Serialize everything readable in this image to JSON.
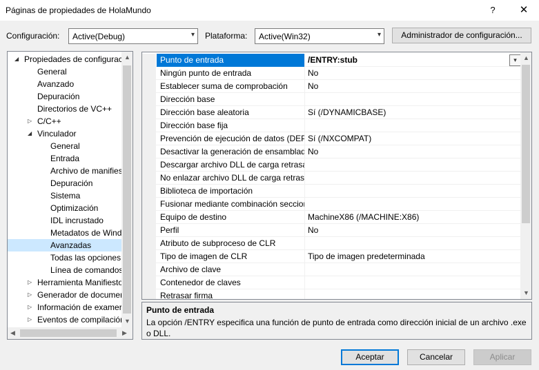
{
  "window": {
    "title": "Páginas de propiedades de HolaMundo",
    "help": "?",
    "close": "✕"
  },
  "config": {
    "label": "Configuración:",
    "value": "Active(Debug)",
    "platform_label": "Plataforma:",
    "platform_value": "Active(Win32)",
    "manager_button": "Administrador de configuración..."
  },
  "tree": {
    "items": [
      {
        "label": "Propiedades de configurac",
        "level": 0,
        "caret": "expanded"
      },
      {
        "label": "General",
        "level": 1
      },
      {
        "label": "Avanzado",
        "level": 1
      },
      {
        "label": "Depuración",
        "level": 1
      },
      {
        "label": "Directorios de VC++",
        "level": 1
      },
      {
        "label": "C/C++",
        "level": 1,
        "caret": "collapsed"
      },
      {
        "label": "Vinculador",
        "level": 1,
        "caret": "expanded"
      },
      {
        "label": "General",
        "level": 2
      },
      {
        "label": "Entrada",
        "level": 2
      },
      {
        "label": "Archivo de manifies",
        "level": 2
      },
      {
        "label": "Depuración",
        "level": 2
      },
      {
        "label": "Sistema",
        "level": 2
      },
      {
        "label": "Optimización",
        "level": 2
      },
      {
        "label": "IDL incrustado",
        "level": 2
      },
      {
        "label": "Metadatos de Wind",
        "level": 2
      },
      {
        "label": "Avanzadas",
        "level": 2,
        "selected": true
      },
      {
        "label": "Todas las opciones",
        "level": 2
      },
      {
        "label": "Línea de comandos",
        "level": 2
      },
      {
        "label": "Herramienta Manifiesto",
        "level": 1,
        "caret": "collapsed"
      },
      {
        "label": "Generador de documer",
        "level": 1,
        "caret": "collapsed"
      },
      {
        "label": "Información de examer",
        "level": 1,
        "caret": "collapsed"
      },
      {
        "label": "Eventos de compilación",
        "level": 1,
        "caret": "collapsed"
      }
    ]
  },
  "grid": {
    "rows": [
      {
        "name": "Punto de entrada",
        "value": "/ENTRY:stub",
        "selected": true
      },
      {
        "name": "Ningún punto de entrada",
        "value": "No"
      },
      {
        "name": "Establecer suma de comprobación",
        "value": "No"
      },
      {
        "name": "Dirección base",
        "value": ""
      },
      {
        "name": "Dirección base aleatoria",
        "value": "Sí (/DYNAMICBASE)"
      },
      {
        "name": "Dirección base fija",
        "value": ""
      },
      {
        "name": "Prevención de ejecución de datos (DEP)",
        "value": "Sí (/NXCOMPAT)"
      },
      {
        "name": "Desactivar la generación de ensamblados",
        "value": "No"
      },
      {
        "name": "Descargar archivo DLL de carga retrasada",
        "value": ""
      },
      {
        "name": "No enlazar archivo DLL de carga retrasada",
        "value": ""
      },
      {
        "name": "Biblioteca de importación",
        "value": ""
      },
      {
        "name": "Fusionar mediante combinación secciones",
        "value": ""
      },
      {
        "name": "Equipo de destino",
        "value": "MachineX86 (/MACHINE:X86)"
      },
      {
        "name": "Perfil",
        "value": "No"
      },
      {
        "name": "Atributo de subproceso de CLR",
        "value": ""
      },
      {
        "name": "Tipo de imagen de CLR",
        "value": "Tipo de imagen predeterminada"
      },
      {
        "name": "Archivo de clave",
        "value": ""
      },
      {
        "name": "Contenedor de claves",
        "value": ""
      },
      {
        "name": "Retrasar firma",
        "value": ""
      }
    ]
  },
  "description": {
    "title": "Punto de entrada",
    "text": "La opción /ENTRY especifica una función de punto de entrada como dirección inicial de un archivo .exe o DLL."
  },
  "buttons": {
    "accept": "Aceptar",
    "cancel": "Cancelar",
    "apply": "Aplicar"
  },
  "icons": {
    "dropdown": "▾",
    "expanded": "◢",
    "collapsed": "▷"
  }
}
